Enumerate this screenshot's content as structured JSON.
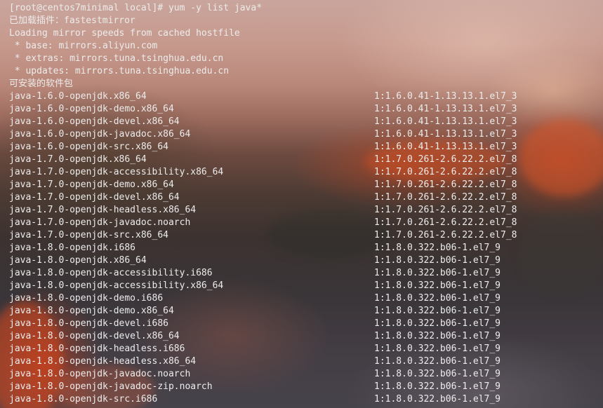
{
  "terminal": {
    "prompt": "[root@centos7minimal local]# ",
    "command": "yum -y list java*",
    "header_lines": [
      "已加载插件：fastestmirror",
      "Loading mirror speeds from cached hostfile",
      " * base: mirrors.aliyun.com",
      " * extras: mirrors.tuna.tsinghua.edu.cn",
      " * updates: mirrors.tuna.tsinghua.edu.cn",
      "可安装的软件包"
    ],
    "packages": [
      {
        "name": "java-1.6.0-openjdk.x86_64",
        "version": "1:1.6.0.41-1.13.13.1.el7_3"
      },
      {
        "name": "java-1.6.0-openjdk-demo.x86_64",
        "version": "1:1.6.0.41-1.13.13.1.el7_3"
      },
      {
        "name": "java-1.6.0-openjdk-devel.x86_64",
        "version": "1:1.6.0.41-1.13.13.1.el7_3"
      },
      {
        "name": "java-1.6.0-openjdk-javadoc.x86_64",
        "version": "1:1.6.0.41-1.13.13.1.el7_3"
      },
      {
        "name": "java-1.6.0-openjdk-src.x86_64",
        "version": "1:1.6.0.41-1.13.13.1.el7_3"
      },
      {
        "name": "java-1.7.0-openjdk.x86_64",
        "version": "1:1.7.0.261-2.6.22.2.el7_8"
      },
      {
        "name": "java-1.7.0-openjdk-accessibility.x86_64",
        "version": "1:1.7.0.261-2.6.22.2.el7_8"
      },
      {
        "name": "java-1.7.0-openjdk-demo.x86_64",
        "version": "1:1.7.0.261-2.6.22.2.el7_8"
      },
      {
        "name": "java-1.7.0-openjdk-devel.x86_64",
        "version": "1:1.7.0.261-2.6.22.2.el7_8"
      },
      {
        "name": "java-1.7.0-openjdk-headless.x86_64",
        "version": "1:1.7.0.261-2.6.22.2.el7_8"
      },
      {
        "name": "java-1.7.0-openjdk-javadoc.noarch",
        "version": "1:1.7.0.261-2.6.22.2.el7_8"
      },
      {
        "name": "java-1.7.0-openjdk-src.x86_64",
        "version": "1:1.7.0.261-2.6.22.2.el7_8"
      },
      {
        "name": "java-1.8.0-openjdk.i686",
        "version": "1:1.8.0.322.b06-1.el7_9"
      },
      {
        "name": "java-1.8.0-openjdk.x86_64",
        "version": "1:1.8.0.322.b06-1.el7_9"
      },
      {
        "name": "java-1.8.0-openjdk-accessibility.i686",
        "version": "1:1.8.0.322.b06-1.el7_9"
      },
      {
        "name": "java-1.8.0-openjdk-accessibility.x86_64",
        "version": "1:1.8.0.322.b06-1.el7_9"
      },
      {
        "name": "java-1.8.0-openjdk-demo.i686",
        "version": "1:1.8.0.322.b06-1.el7_9"
      },
      {
        "name": "java-1.8.0-openjdk-demo.x86_64",
        "version": "1:1.8.0.322.b06-1.el7_9"
      },
      {
        "name": "java-1.8.0-openjdk-devel.i686",
        "version": "1:1.8.0.322.b06-1.el7_9"
      },
      {
        "name": "java-1.8.0-openjdk-devel.x86_64",
        "version": "1:1.8.0.322.b06-1.el7_9"
      },
      {
        "name": "java-1.8.0-openjdk-headless.i686",
        "version": "1:1.8.0.322.b06-1.el7_9"
      },
      {
        "name": "java-1.8.0-openjdk-headless.x86_64",
        "version": "1:1.8.0.322.b06-1.el7_9"
      },
      {
        "name": "java-1.8.0-openjdk-javadoc.noarch",
        "version": "1:1.8.0.322.b06-1.el7_9"
      },
      {
        "name": "java-1.8.0-openjdk-javadoc-zip.noarch",
        "version": "1:1.8.0.322.b06-1.el7_9"
      },
      {
        "name": "java-1.8.0-openjdk-src.i686",
        "version": "1:1.8.0.322.b06-1.el7_9"
      }
    ],
    "text_color": "#ececec"
  }
}
